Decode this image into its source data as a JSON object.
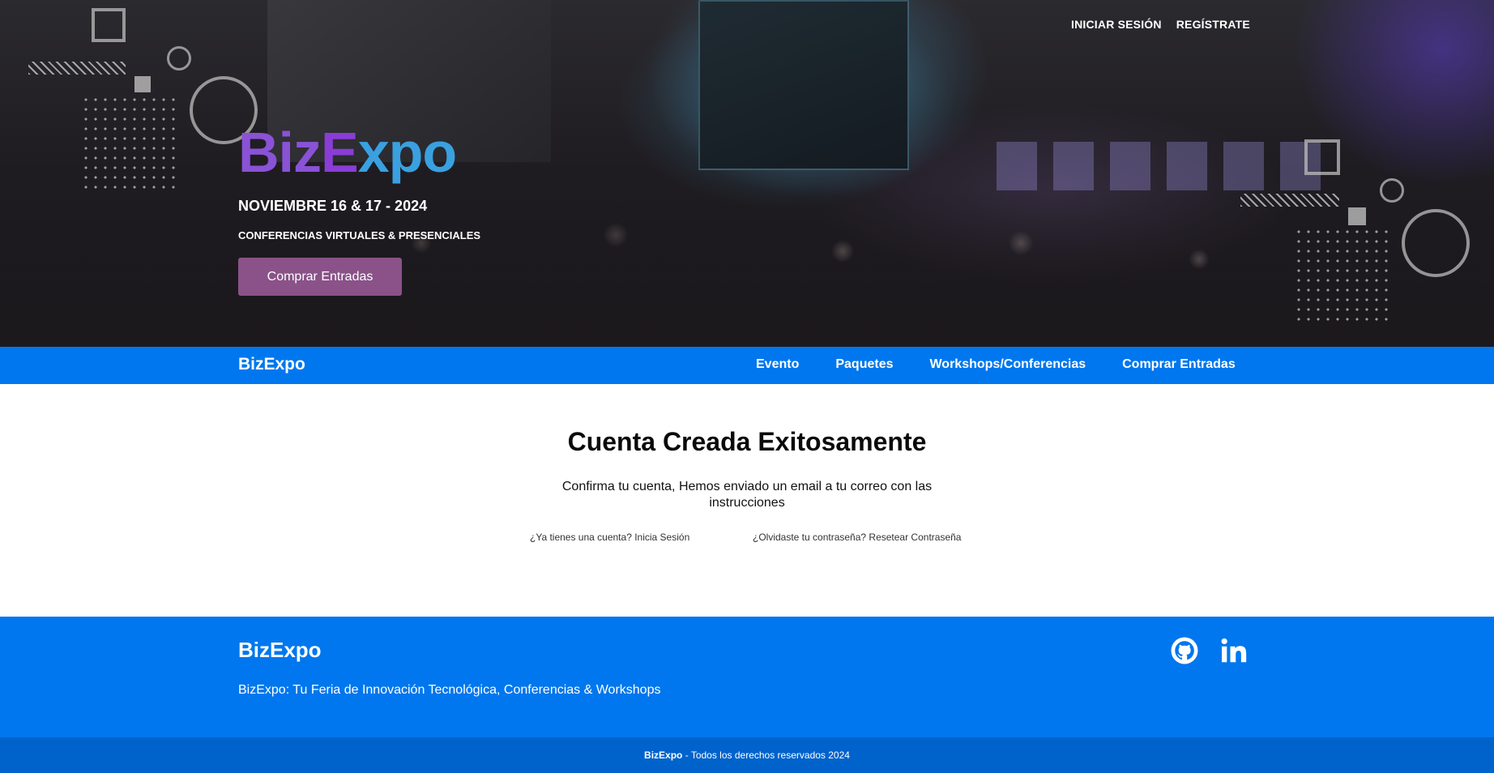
{
  "hero": {
    "top_links": {
      "login": "INICIAR SESIÓN",
      "register": "REGÍSTRATE"
    },
    "logo": {
      "part1": "Biz",
      "part2": "E",
      "part3": "xpo"
    },
    "date": "NOVIEMBRE 16 & 17 - 2024",
    "subtitle": "CONFERENCIAS VIRTUALES & PRESENCIALES",
    "buy_button": "Comprar Entradas"
  },
  "navbar": {
    "logo": "BizExpo",
    "links": [
      "Evento",
      "Paquetes",
      "Workshops/Conferencias",
      "Comprar Entradas"
    ]
  },
  "main": {
    "title": "Cuenta Creada Exitosamente",
    "message": "Confirma tu cuenta, Hemos enviado un email a tu correo con las instrucciones",
    "login_link": "¿Ya tienes una cuenta? Inicia Sesión",
    "reset_link": "¿Olvidaste tu contraseña? Resetear Contraseña"
  },
  "footer": {
    "logo": "BizExpo",
    "tagline": "BizExpo: Tu Feria de Innovación Tecnológica, Conferencias & Workshops",
    "social_icons": [
      "github-icon",
      "linkedin-icon"
    ],
    "copyright_brand": "BizExpo",
    "copyright_text": " - Todos los derechos reservados 2024"
  },
  "colors": {
    "primary_blue": "#0077ee",
    "dark_blue": "#0063cc",
    "button_purple": "#8a5289",
    "logo_purple": "#8a52d6",
    "logo_cyan": "#3aa0e0"
  }
}
